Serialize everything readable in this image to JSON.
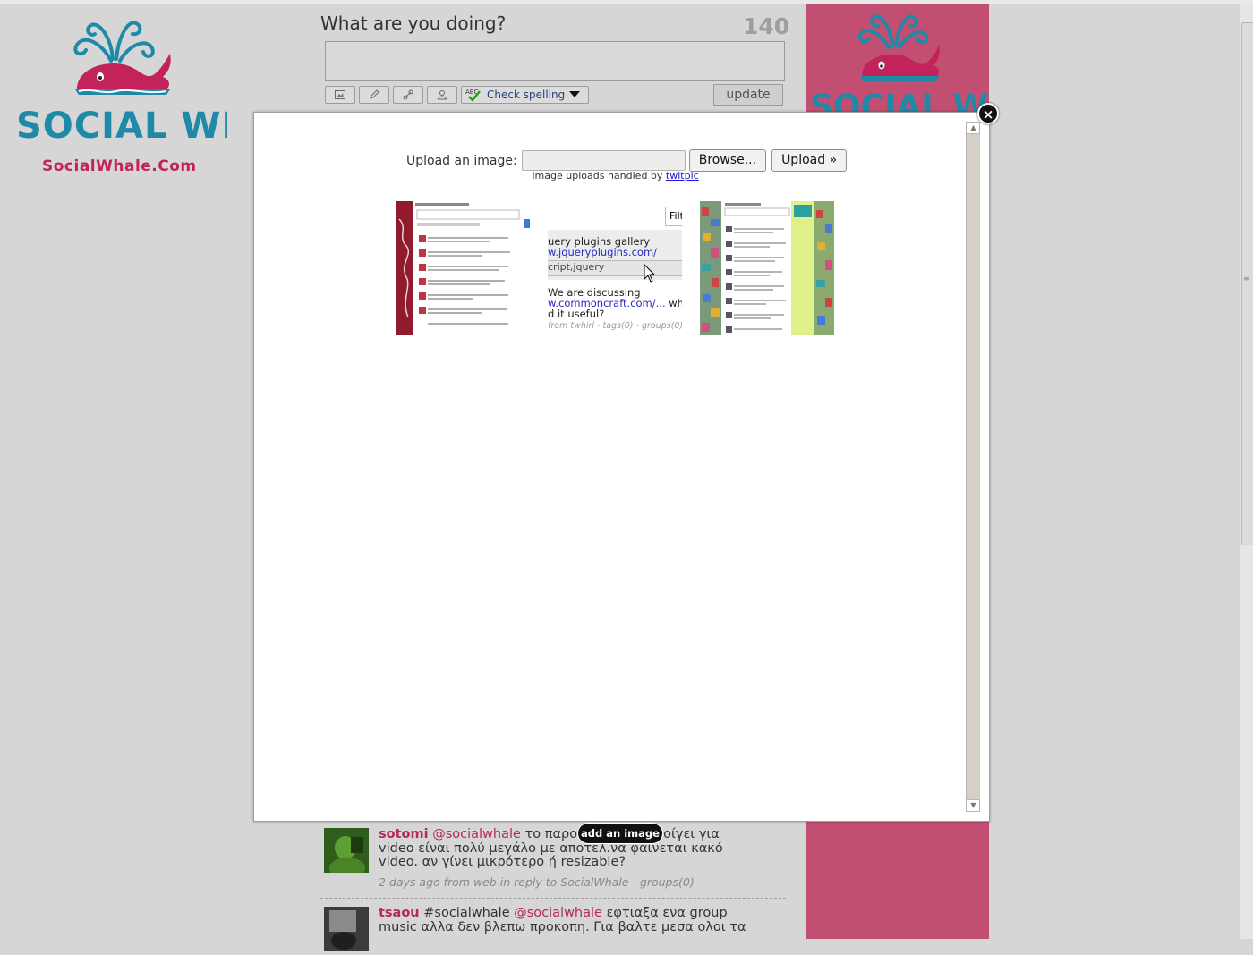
{
  "brand": {
    "logo_text": "SOCIAL WHALE",
    "site_url": "SocialWhale.Com"
  },
  "compose": {
    "title": "What are you doing?",
    "counter": "140",
    "spell_label": "Check spelling",
    "update_label": "update",
    "toolbar_icons": [
      "image-icon",
      "pencil-icon",
      "link-icon",
      "person-icon"
    ]
  },
  "modal": {
    "upload_label": "Upload an image:",
    "browse_label": "Browse...",
    "upload_button": "Upload »",
    "handled_prefix": "Image uploads handled by",
    "handled_link": "twitpic",
    "thumb2": {
      "filter_label": "Filt",
      "line1": "uery plugins gallery",
      "line2": "w.jqueryplugins.com/",
      "line3": "cript,jquery",
      "line4": "We are discussing",
      "line5": "w.commoncraft.com/...",
      "line5b": "whic",
      "line6": "d it useful?",
      "line7": "from twhirl - tags(0) - groups(0)"
    }
  },
  "tooltip": {
    "add_image": "add an image"
  },
  "tweets": [
    {
      "user": "sotomi",
      "mention": "@socialwhale",
      "text": "το παρο... άνοίγει για video είναι πολύ μεγάλο με αποτέλ.να φαίνεται κακό video. αν γίνει μικρότερο ή resizable?",
      "text_a": "το παρο",
      "text_b": "οίγει για",
      "text_c": "video είναι πολύ μεγάλο με αποτέλ.να φαίνεται κακό",
      "text_d": "video. αν γίνει μικρότερο ή resizable?",
      "meta": "2 days ago from web in reply to SocialWhale - groups(0)"
    },
    {
      "user": "tsaou",
      "hashtag": "#socialwhale",
      "mention": "@socialwhale",
      "text_a": "εφτιαξα ενα group",
      "text_b": "music αλλα δεν βλεπω προκοπη. Για βαλτε μεσα ολοι τα"
    }
  ],
  "colors": {
    "brand_pink": "#c2245a",
    "side_column": "#c24f72",
    "overlay_gray": "#d6d6d6"
  }
}
